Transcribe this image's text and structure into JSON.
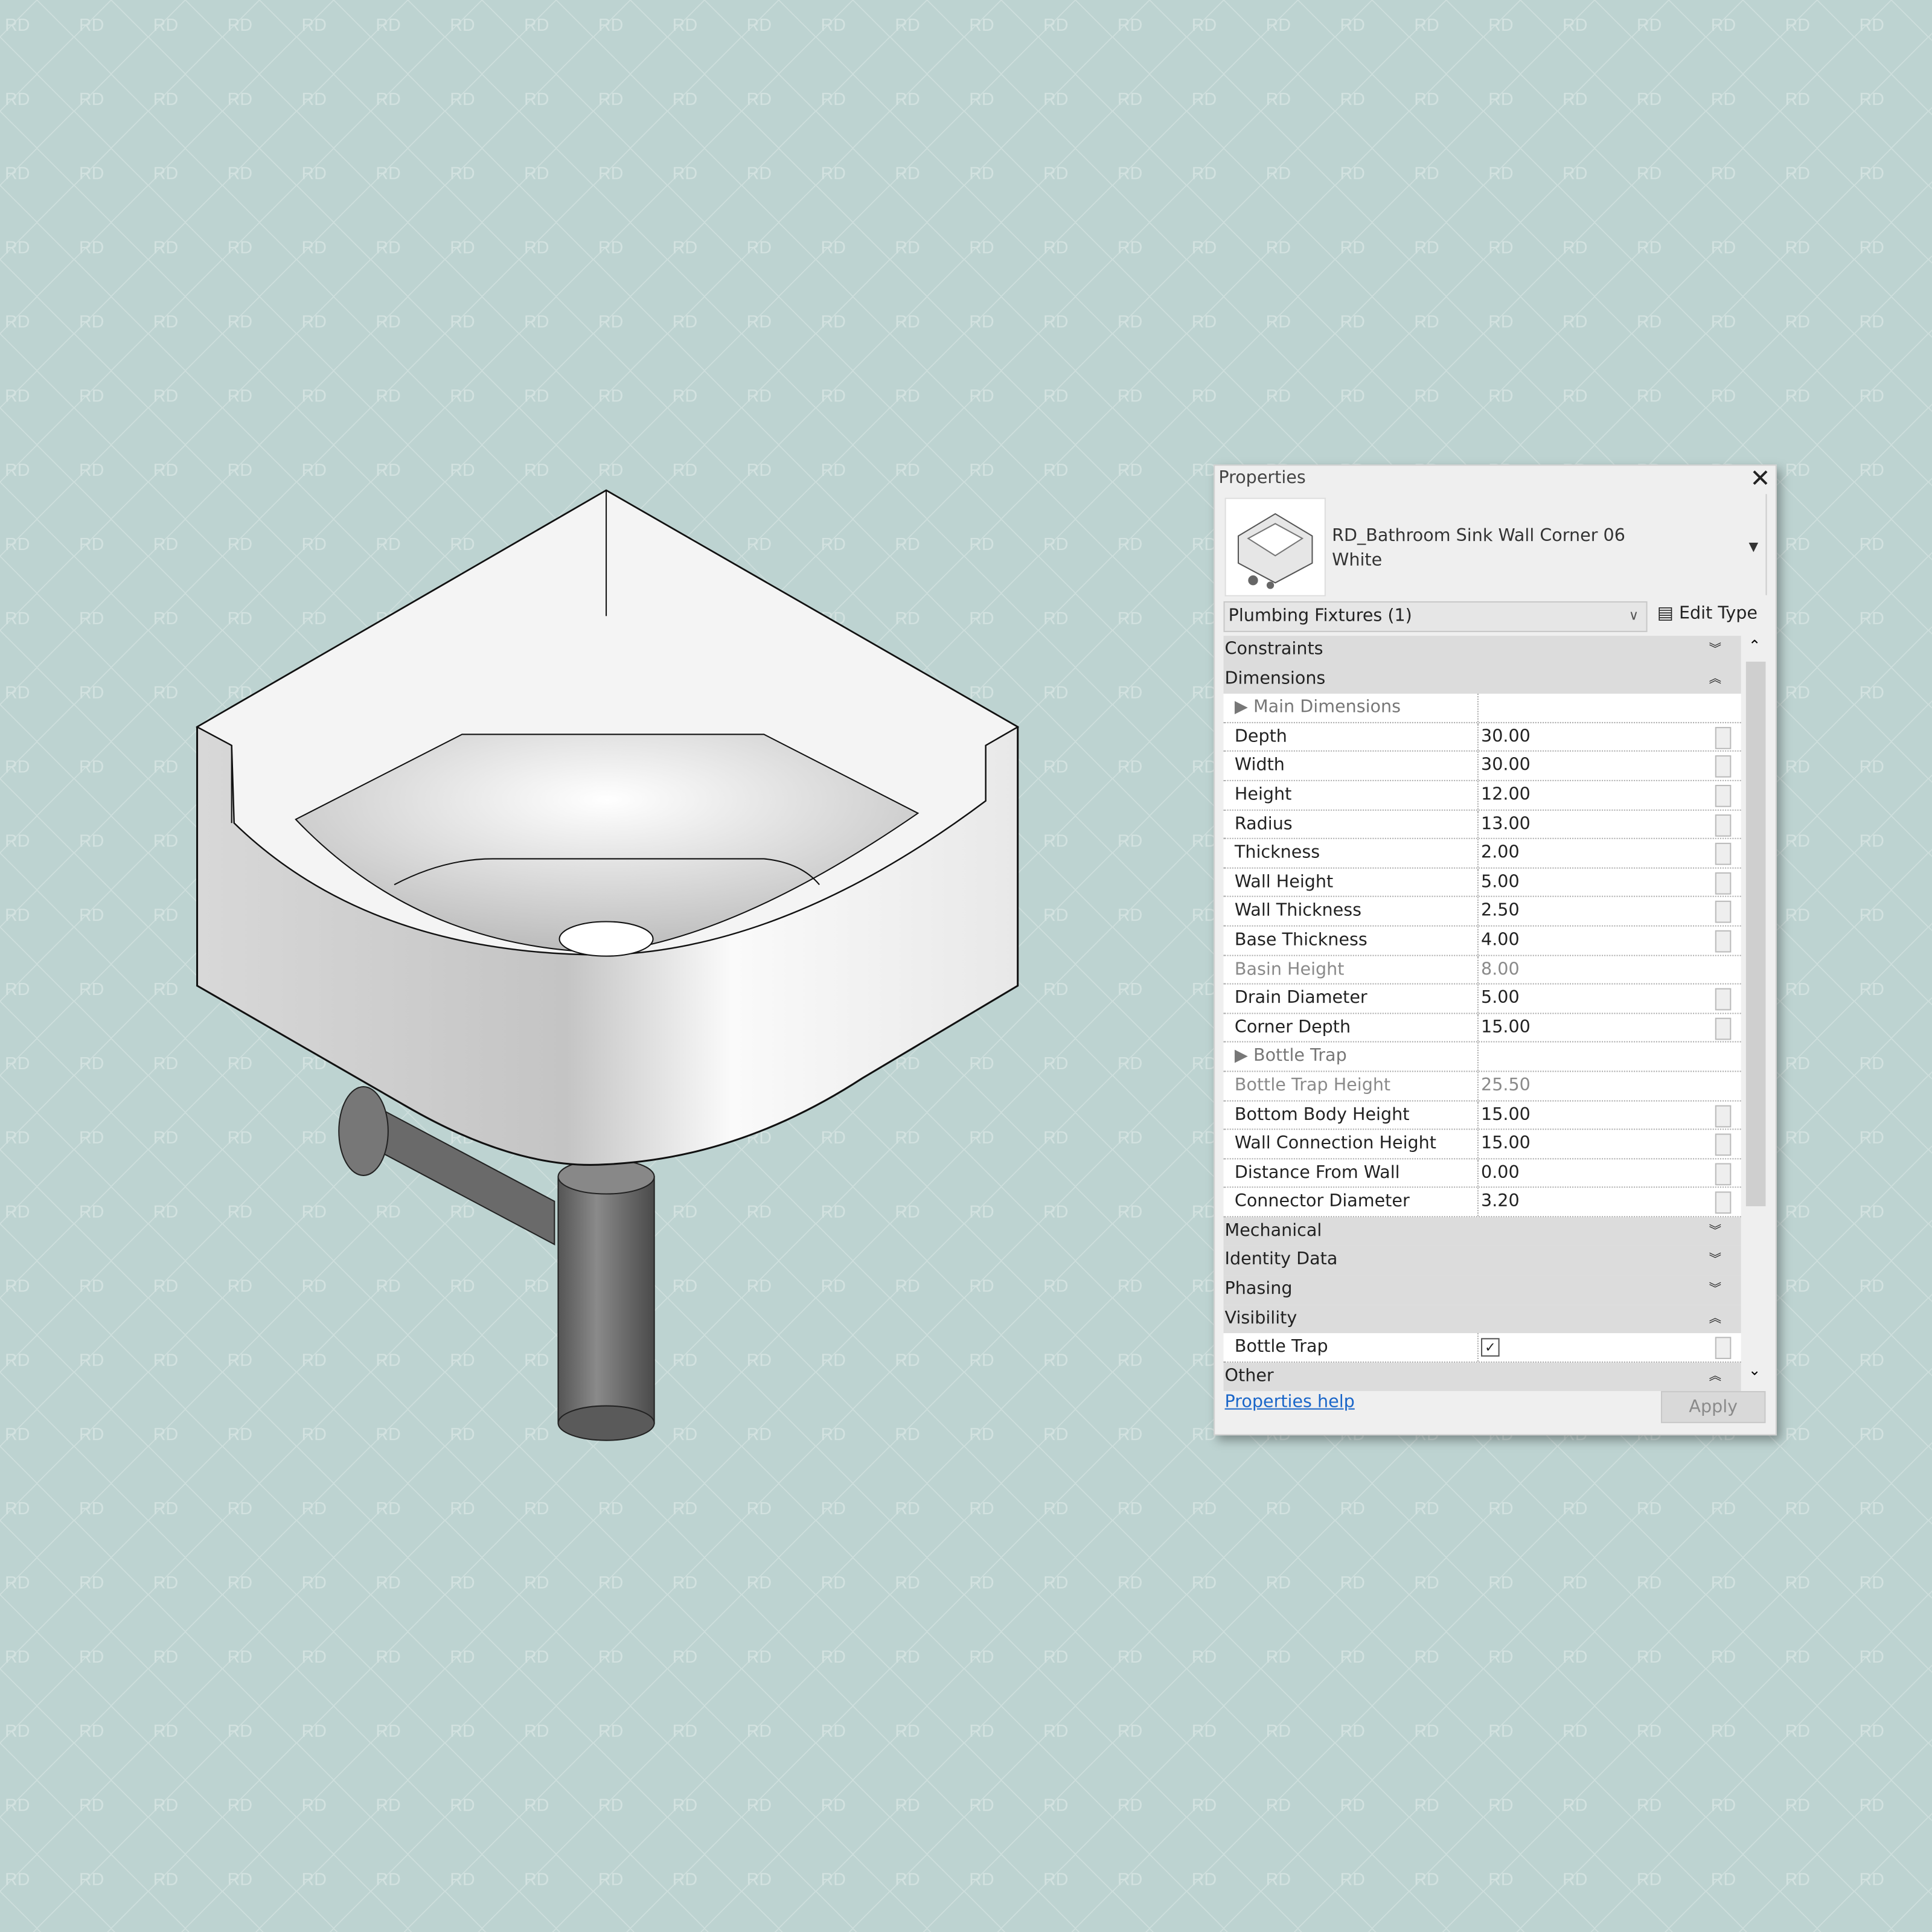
{
  "watermark": "RD",
  "colors": {
    "background": "#bdd3d1",
    "panel": "#efefef",
    "group_header": "#dcdcdc",
    "link": "#1a66c9"
  },
  "panel": {
    "title": "Properties",
    "close_icon": "close-icon",
    "type_name_line1": "RD_Bathroom Sink Wall Corner 06",
    "type_name_line2": "White",
    "category": "Plumbing Fixtures (1)",
    "edit_type": "Edit Type",
    "help": "Properties help",
    "apply": "Apply",
    "rows": [
      {
        "kind": "group",
        "label": "Constraints",
        "toggle": "expand"
      },
      {
        "kind": "group",
        "label": "Dimensions",
        "toggle": "collapse"
      },
      {
        "kind": "sub",
        "label": "Main Dimensions",
        "value": ""
      },
      {
        "kind": "param",
        "label": "Depth",
        "value": "30.00"
      },
      {
        "kind": "param",
        "label": "Width",
        "value": "30.00"
      },
      {
        "kind": "param",
        "label": "Height",
        "value": "12.00"
      },
      {
        "kind": "param",
        "label": "Radius",
        "value": "13.00"
      },
      {
        "kind": "param",
        "label": "Thickness",
        "value": "2.00"
      },
      {
        "kind": "param",
        "label": "Wall Height",
        "value": "5.00"
      },
      {
        "kind": "param",
        "label": "Wall Thickness",
        "value": "2.50"
      },
      {
        "kind": "param",
        "label": "Base Thickness",
        "value": "4.00"
      },
      {
        "kind": "readonly",
        "label": "Basin Height",
        "value": "8.00"
      },
      {
        "kind": "param",
        "label": "Drain Diameter",
        "value": "5.00"
      },
      {
        "kind": "param",
        "label": "Corner Depth",
        "value": "15.00"
      },
      {
        "kind": "sub",
        "label": "Bottle Trap",
        "value": ""
      },
      {
        "kind": "readonly",
        "label": "Bottle Trap Height",
        "value": "25.50"
      },
      {
        "kind": "param",
        "label": "Bottom Body Height",
        "value": "15.00"
      },
      {
        "kind": "param",
        "label": "Wall Connection Height",
        "value": "15.00"
      },
      {
        "kind": "param",
        "label": "Distance From Wall",
        "value": "0.00"
      },
      {
        "kind": "param",
        "label": "Connector Diameter",
        "value": "3.20"
      },
      {
        "kind": "group",
        "label": "Mechanical",
        "toggle": "expand"
      },
      {
        "kind": "group",
        "label": "Identity Data",
        "toggle": "expand"
      },
      {
        "kind": "group",
        "label": "Phasing",
        "toggle": "expand"
      },
      {
        "kind": "group",
        "label": "Visibility",
        "toggle": "collapse"
      },
      {
        "kind": "check",
        "label": "Bottle Trap",
        "checked": true
      },
      {
        "kind": "group",
        "label": "Other",
        "toggle": "collapse"
      }
    ]
  }
}
